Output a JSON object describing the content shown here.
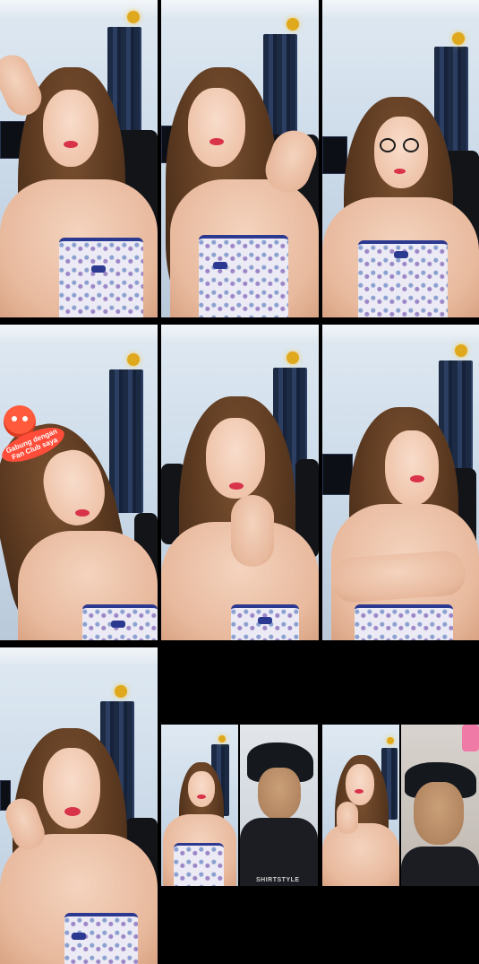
{
  "grid": {
    "background": "#000000"
  },
  "tiles": [
    {
      "label": "stream-1"
    },
    {
      "label": "stream-2"
    },
    {
      "label": "stream-3"
    },
    {
      "label": "stream-4"
    },
    {
      "label": "stream-5"
    },
    {
      "label": "stream-6"
    },
    {
      "label": "stream-7"
    },
    {
      "label": "stream-8-pk-battle"
    }
  ],
  "fan_club_badge": {
    "text": "Gabung dengan Fan Club saya",
    "color": "#ff4d3a",
    "icon": "mascot-icon"
  },
  "shirt_print": {
    "text": "SHIRTSTYLE"
  },
  "colors": {
    "accent": "#2c3990",
    "lips": "#d9334a",
    "badge": "#ff4d3a"
  }
}
